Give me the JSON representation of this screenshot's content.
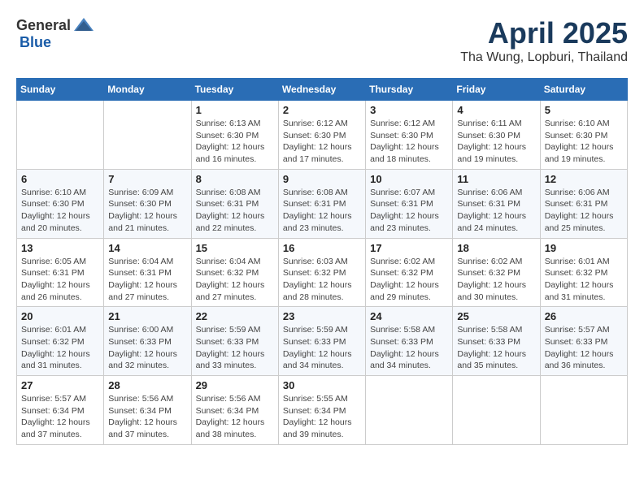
{
  "header": {
    "logo_general": "General",
    "logo_blue": "Blue",
    "month_year": "April 2025",
    "location": "Tha Wung, Lopburi, Thailand"
  },
  "weekdays": [
    "Sunday",
    "Monday",
    "Tuesday",
    "Wednesday",
    "Thursday",
    "Friday",
    "Saturday"
  ],
  "weeks": [
    [
      {
        "day": "",
        "sunrise": "",
        "sunset": "",
        "daylight": ""
      },
      {
        "day": "",
        "sunrise": "",
        "sunset": "",
        "daylight": ""
      },
      {
        "day": "1",
        "sunrise": "Sunrise: 6:13 AM",
        "sunset": "Sunset: 6:30 PM",
        "daylight": "Daylight: 12 hours and 16 minutes."
      },
      {
        "day": "2",
        "sunrise": "Sunrise: 6:12 AM",
        "sunset": "Sunset: 6:30 PM",
        "daylight": "Daylight: 12 hours and 17 minutes."
      },
      {
        "day": "3",
        "sunrise": "Sunrise: 6:12 AM",
        "sunset": "Sunset: 6:30 PM",
        "daylight": "Daylight: 12 hours and 18 minutes."
      },
      {
        "day": "4",
        "sunrise": "Sunrise: 6:11 AM",
        "sunset": "Sunset: 6:30 PM",
        "daylight": "Daylight: 12 hours and 19 minutes."
      },
      {
        "day": "5",
        "sunrise": "Sunrise: 6:10 AM",
        "sunset": "Sunset: 6:30 PM",
        "daylight": "Daylight: 12 hours and 19 minutes."
      }
    ],
    [
      {
        "day": "6",
        "sunrise": "Sunrise: 6:10 AM",
        "sunset": "Sunset: 6:30 PM",
        "daylight": "Daylight: 12 hours and 20 minutes."
      },
      {
        "day": "7",
        "sunrise": "Sunrise: 6:09 AM",
        "sunset": "Sunset: 6:30 PM",
        "daylight": "Daylight: 12 hours and 21 minutes."
      },
      {
        "day": "8",
        "sunrise": "Sunrise: 6:08 AM",
        "sunset": "Sunset: 6:31 PM",
        "daylight": "Daylight: 12 hours and 22 minutes."
      },
      {
        "day": "9",
        "sunrise": "Sunrise: 6:08 AM",
        "sunset": "Sunset: 6:31 PM",
        "daylight": "Daylight: 12 hours and 23 minutes."
      },
      {
        "day": "10",
        "sunrise": "Sunrise: 6:07 AM",
        "sunset": "Sunset: 6:31 PM",
        "daylight": "Daylight: 12 hours and 23 minutes."
      },
      {
        "day": "11",
        "sunrise": "Sunrise: 6:06 AM",
        "sunset": "Sunset: 6:31 PM",
        "daylight": "Daylight: 12 hours and 24 minutes."
      },
      {
        "day": "12",
        "sunrise": "Sunrise: 6:06 AM",
        "sunset": "Sunset: 6:31 PM",
        "daylight": "Daylight: 12 hours and 25 minutes."
      }
    ],
    [
      {
        "day": "13",
        "sunrise": "Sunrise: 6:05 AM",
        "sunset": "Sunset: 6:31 PM",
        "daylight": "Daylight: 12 hours and 26 minutes."
      },
      {
        "day": "14",
        "sunrise": "Sunrise: 6:04 AM",
        "sunset": "Sunset: 6:31 PM",
        "daylight": "Daylight: 12 hours and 27 minutes."
      },
      {
        "day": "15",
        "sunrise": "Sunrise: 6:04 AM",
        "sunset": "Sunset: 6:32 PM",
        "daylight": "Daylight: 12 hours and 27 minutes."
      },
      {
        "day": "16",
        "sunrise": "Sunrise: 6:03 AM",
        "sunset": "Sunset: 6:32 PM",
        "daylight": "Daylight: 12 hours and 28 minutes."
      },
      {
        "day": "17",
        "sunrise": "Sunrise: 6:02 AM",
        "sunset": "Sunset: 6:32 PM",
        "daylight": "Daylight: 12 hours and 29 minutes."
      },
      {
        "day": "18",
        "sunrise": "Sunrise: 6:02 AM",
        "sunset": "Sunset: 6:32 PM",
        "daylight": "Daylight: 12 hours and 30 minutes."
      },
      {
        "day": "19",
        "sunrise": "Sunrise: 6:01 AM",
        "sunset": "Sunset: 6:32 PM",
        "daylight": "Daylight: 12 hours and 31 minutes."
      }
    ],
    [
      {
        "day": "20",
        "sunrise": "Sunrise: 6:01 AM",
        "sunset": "Sunset: 6:32 PM",
        "daylight": "Daylight: 12 hours and 31 minutes."
      },
      {
        "day": "21",
        "sunrise": "Sunrise: 6:00 AM",
        "sunset": "Sunset: 6:33 PM",
        "daylight": "Daylight: 12 hours and 32 minutes."
      },
      {
        "day": "22",
        "sunrise": "Sunrise: 5:59 AM",
        "sunset": "Sunset: 6:33 PM",
        "daylight": "Daylight: 12 hours and 33 minutes."
      },
      {
        "day": "23",
        "sunrise": "Sunrise: 5:59 AM",
        "sunset": "Sunset: 6:33 PM",
        "daylight": "Daylight: 12 hours and 34 minutes."
      },
      {
        "day": "24",
        "sunrise": "Sunrise: 5:58 AM",
        "sunset": "Sunset: 6:33 PM",
        "daylight": "Daylight: 12 hours and 34 minutes."
      },
      {
        "day": "25",
        "sunrise": "Sunrise: 5:58 AM",
        "sunset": "Sunset: 6:33 PM",
        "daylight": "Daylight: 12 hours and 35 minutes."
      },
      {
        "day": "26",
        "sunrise": "Sunrise: 5:57 AM",
        "sunset": "Sunset: 6:33 PM",
        "daylight": "Daylight: 12 hours and 36 minutes."
      }
    ],
    [
      {
        "day": "27",
        "sunrise": "Sunrise: 5:57 AM",
        "sunset": "Sunset: 6:34 PM",
        "daylight": "Daylight: 12 hours and 37 minutes."
      },
      {
        "day": "28",
        "sunrise": "Sunrise: 5:56 AM",
        "sunset": "Sunset: 6:34 PM",
        "daylight": "Daylight: 12 hours and 37 minutes."
      },
      {
        "day": "29",
        "sunrise": "Sunrise: 5:56 AM",
        "sunset": "Sunset: 6:34 PM",
        "daylight": "Daylight: 12 hours and 38 minutes."
      },
      {
        "day": "30",
        "sunrise": "Sunrise: 5:55 AM",
        "sunset": "Sunset: 6:34 PM",
        "daylight": "Daylight: 12 hours and 39 minutes."
      },
      {
        "day": "",
        "sunrise": "",
        "sunset": "",
        "daylight": ""
      },
      {
        "day": "",
        "sunrise": "",
        "sunset": "",
        "daylight": ""
      },
      {
        "day": "",
        "sunrise": "",
        "sunset": "",
        "daylight": ""
      }
    ]
  ]
}
